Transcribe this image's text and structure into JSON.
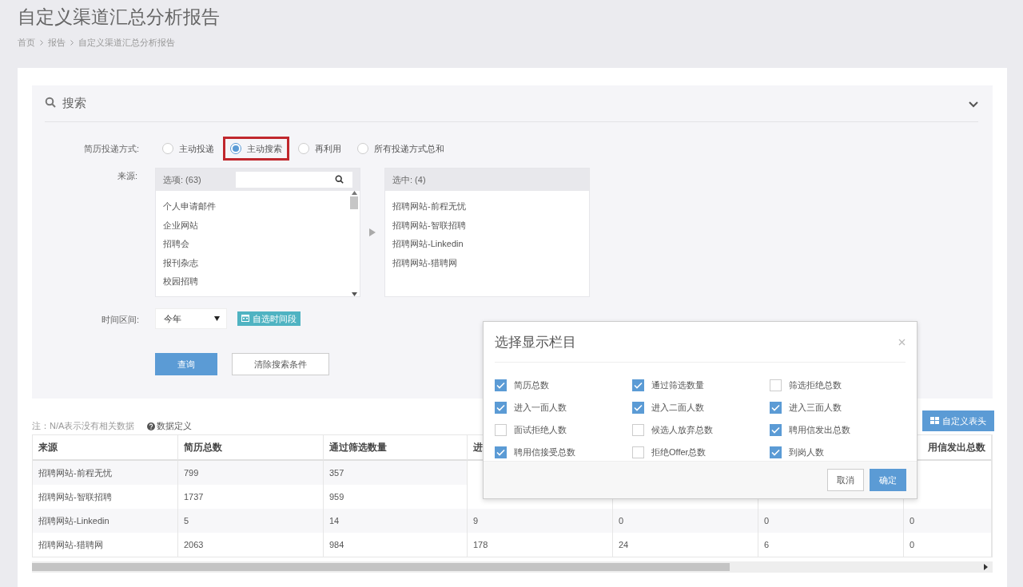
{
  "page": {
    "title": "自定义渠道汇总分析报告",
    "breadcrumb": [
      "首页",
      "报告",
      "自定义渠道汇总分析报告"
    ]
  },
  "search": {
    "title": "搜索",
    "expanded": true,
    "delivery": {
      "label": "简历投递方式:",
      "options": [
        {
          "label": "主动投递",
          "selected": false,
          "highlighted": false
        },
        {
          "label": "主动搜索",
          "selected": true,
          "highlighted": true
        },
        {
          "label": "再利用",
          "selected": false,
          "highlighted": false
        },
        {
          "label": "所有投递方式总和",
          "selected": false,
          "highlighted": false
        }
      ]
    },
    "source": {
      "label": "来源:",
      "available_header": "选项: (63)",
      "available": [
        "个人申请邮件",
        "企业网站",
        "招聘会",
        "报刊杂志",
        "校园招聘"
      ],
      "selected_header": "选中: (4)",
      "selected_items": [
        "招聘网站-前程无忧",
        "招聘网站-智联招聘",
        "招聘网站-Linkedin",
        "招聘网站-猎聘网"
      ]
    },
    "time": {
      "label": "时间区间:",
      "value": "今年",
      "custom_button": "自选时间段"
    },
    "buttons": [
      {
        "label": "查询",
        "kind": "primary"
      },
      {
        "label": "清除搜索条件",
        "kind": "default"
      }
    ]
  },
  "note": "注：N/A表示没有相关数据",
  "definition_link": "数据定义",
  "customize_button": "自定义表头",
  "table": {
    "columns": [
      "来源",
      "简历总数",
      "通过筛选数量",
      "进",
      null,
      null,
      "用信发出总数"
    ],
    "rows": [
      [
        "招聘网站-前程无忧",
        "799",
        "357",
        null,
        null,
        null,
        null
      ],
      [
        "招聘网站-智联招聘",
        "1737",
        "959",
        null,
        null,
        null,
        null
      ],
      [
        "招聘网站-Linkedin",
        "5",
        "14",
        "9",
        "0",
        "0",
        "0"
      ],
      [
        "招聘网站-猎聘网",
        "2063",
        "984",
        "178",
        "24",
        "6",
        "0"
      ]
    ]
  },
  "dialog": {
    "title": "选择显示栏目",
    "options": [
      {
        "label": "简历总数",
        "checked": true
      },
      {
        "label": "通过筛选数量",
        "checked": true
      },
      {
        "label": "筛选拒绝总数",
        "checked": false
      },
      {
        "label": "进入一面人数",
        "checked": true
      },
      {
        "label": "进入二面人数",
        "checked": true
      },
      {
        "label": "进入三面人数",
        "checked": true
      },
      {
        "label": "面试拒绝人数",
        "checked": false
      },
      {
        "label": "候选人放弃总数",
        "checked": false
      },
      {
        "label": "聘用信发出总数",
        "checked": true
      },
      {
        "label": "聘用信接受总数",
        "checked": true
      },
      {
        "label": "拒绝Offer总数",
        "checked": false
      },
      {
        "label": "到岗人数",
        "checked": true
      }
    ],
    "buttons": [
      {
        "label": "取消",
        "kind": "default"
      },
      {
        "label": "确定",
        "kind": "primary"
      }
    ]
  }
}
